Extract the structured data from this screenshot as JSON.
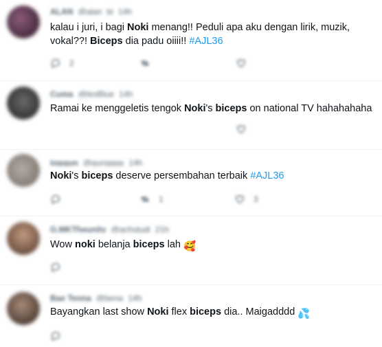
{
  "tweets": [
    {
      "author": "ALAN",
      "handle": "@alan_bi",
      "time": "14h",
      "text": {
        "p1": "kalau i juri, i bagi ",
        "b1": "Noki",
        "p2": " menang!! Peduli apa aku dengan lirik, muzik, vokal??! ",
        "b2": "Biceps",
        "p3": " dia padu oiiii!! ",
        "tag": "#AJL36"
      },
      "reply_count": "2",
      "avatar_color": "#4a2c40"
    },
    {
      "author": "Cuma",
      "handle": "@leoBlue",
      "time": "14h",
      "text": {
        "p1": "Ramai ke menggeletis tengok ",
        "b1": "Noki",
        "p2": "'s ",
        "b2": "biceps",
        "p3": " on national TV hahahahaha"
      },
      "avatar_color": "#3b3b3b"
    },
    {
      "author": "topgun",
      "handle": "@gunggga",
      "time": "14h",
      "text": {
        "b1": "Noki",
        "p2": "'s ",
        "b2": "biceps",
        "p3": " deserve persembahan terbaik ",
        "tag": "#AJL36"
      },
      "retweet_count": "1",
      "like_count": "3",
      "avatar_color": "#8f8680"
    },
    {
      "author": "G.MKTheunity",
      "handle": "@achstudi",
      "time": "21h",
      "text": {
        "p1": "Wow ",
        "b1": "noki",
        "p2": " belanja ",
        "b2": "biceps",
        "p3": " lah ",
        "emoji": "🥰"
      },
      "avatar_color": "#7c5a48"
    },
    {
      "author": "Bae Tenna",
      "handle": "@bena",
      "time": "14h",
      "text": {
        "p1": "Bayangkan last show ",
        "b1": "Noki",
        "p2": " flex ",
        "b2": "biceps",
        "p3": " dia.. Maigadddd ",
        "emoji": "💦"
      },
      "avatar_color": "#5d4a3e"
    }
  ],
  "icons": {
    "reply": "reply-icon",
    "retweet": "retweet-icon",
    "like": "heart-icon",
    "share": "share-icon"
  },
  "colors": {
    "hashtag": "#1d9bf0",
    "text": "#0f1419",
    "muted": "#536471"
  }
}
